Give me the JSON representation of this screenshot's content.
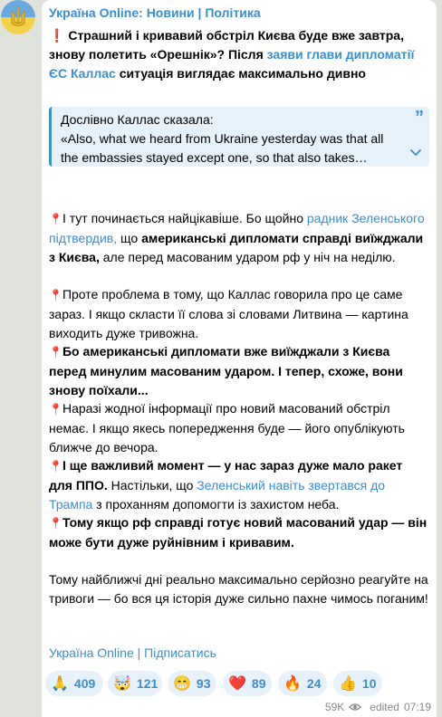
{
  "channel": {
    "name": "Україна Online: Новини | Політика"
  },
  "headline": {
    "emoji": "❗",
    "text_a": "Страшний і кривавий обстріл Києва буде вже завтра, знову полетить «Орешнік»? Після ",
    "link": "заяви глави дипломатії ЄС Каллас",
    "text_b": " ситуація виглядає максимально дивно"
  },
  "quote": {
    "line1": "Дослівно Каллас сказала:",
    "line2": "«Also, what we heard from Ukraine yesterday was that all",
    "line3": "the embassies stayed except one, so that also takes…"
  },
  "body": {
    "pin": "📍",
    "p1_a": "І тут починається найцікавіше. Бо щойно ",
    "p1_link": "радник Зеленського підтвердив,",
    "p1_b": " що ",
    "p1_bold": "американські дипломати справді виїжджали з Києва,",
    "p1_c": " але перед масованим ударом рф у ніч на неділю.",
    "p2": "Проте проблема в тому, що Каллас говорила про це саме зараз. І якщо скласти її слова зі словами Литвина — картина виходить дуже тривожна.",
    "p3": "Бо американські дипломати вже виїжджали з Києва перед минулим масованим ударом. І тепер, схоже, вони знову поїхали...",
    "p4": "Наразі жодної інформації про новий масований обстріл немає. І якщо якесь попередження буде — його опублікують ближче до вечора.",
    "p5_bold": "І ще важливий момент — у нас зараз дуже мало ракет для ППО.",
    "p5_a": " Настільки, що ",
    "p5_link": "Зеленський навіть звертався до Трампа",
    "p5_b": " з проханням допомогти із захистом неба.",
    "p6": "Тому якщо рф справді готує новий масований удар — він може бути дуже руйнівним і кривавим.",
    "p7": "Тому найближчі дні реально максимально серйозно реагуйте на тривоги — бо вся ця історія дуже сильно пахне чимось поганим!"
  },
  "footer": {
    "subscribe": "Україна Online | Підписатись"
  },
  "reactions": [
    {
      "emoji": "🙏",
      "count": "409"
    },
    {
      "emoji": "🤯",
      "count": "121"
    },
    {
      "emoji": "😁",
      "count": "93"
    },
    {
      "emoji": "❤️",
      "count": "89"
    },
    {
      "emoji": "🔥",
      "count": "24"
    },
    {
      "emoji": "👍",
      "count": "10"
    }
  ],
  "meta": {
    "views": "59K",
    "edited": "edited",
    "time": "07:19"
  },
  "icons": {
    "eye": "eye-icon",
    "quote": "quote-icon",
    "expand": "chevron-down-icon"
  },
  "colors": {
    "accent": "#3a8fcf",
    "quote_bg": "#e7f1fa",
    "background": "#dfe3dc"
  }
}
